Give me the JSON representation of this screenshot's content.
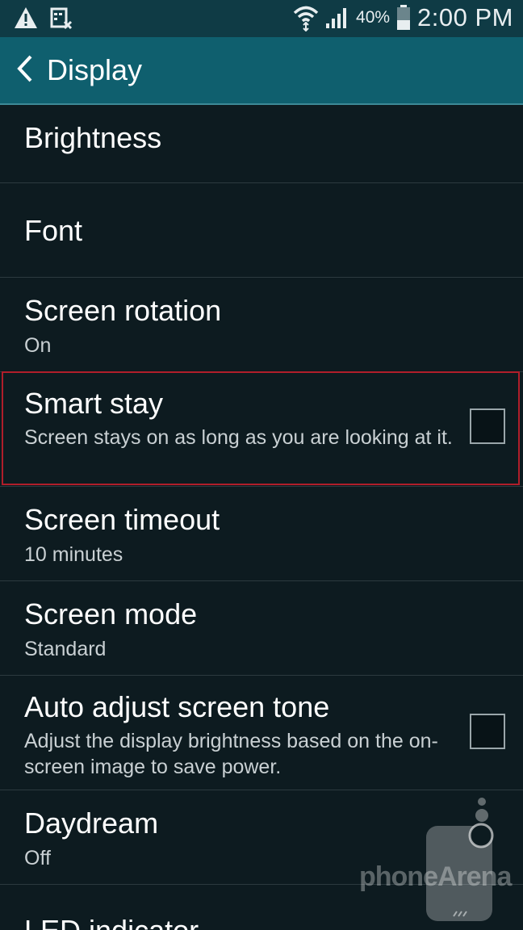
{
  "status_bar": {
    "battery_percent": "40%",
    "time": "2:00 PM"
  },
  "header": {
    "title": "Display"
  },
  "settings": [
    {
      "label": "Brightness"
    },
    {
      "label": "Font"
    },
    {
      "label": "Screen rotation",
      "value": "On"
    },
    {
      "label": "Smart stay",
      "description": "Screen stays on as long as you are looking at it.",
      "checked": false
    },
    {
      "label": "Screen timeout",
      "value": "10 minutes"
    },
    {
      "label": "Screen mode",
      "value": "Standard"
    },
    {
      "label": "Auto adjust screen tone",
      "description": "Adjust the display brightness based on the on-screen image to save power.",
      "checked": false
    },
    {
      "label": "Daydream",
      "value": "Off"
    },
    {
      "label": "LED indicator"
    }
  ],
  "watermark": {
    "text": "phoneArena"
  },
  "colors": {
    "status_bar": "#0f3b45",
    "action_bar": "#0f5f6e",
    "background": "#0d1b20",
    "highlight": "#b01e2a"
  }
}
